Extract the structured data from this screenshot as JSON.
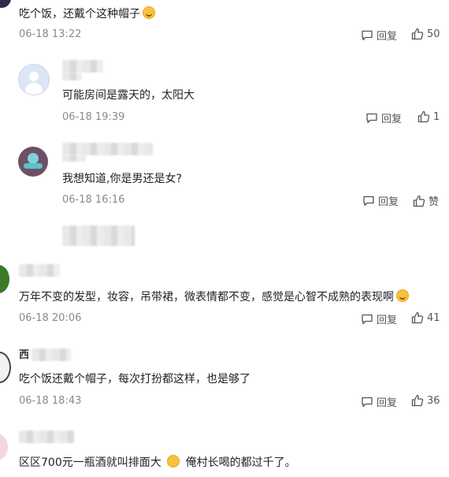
{
  "comments": [
    {
      "text": "吃个饭，还戴个这种帽子",
      "time": "06-18 13:22",
      "reply": "回复",
      "likes": "50"
    },
    {
      "text": "可能房间是露天的，太阳大",
      "time": "06-18 19:39",
      "reply": "回复",
      "likes": "1"
    },
    {
      "text": "我想知道,你是男还是女?",
      "time": "06-18 16:16",
      "reply": "回复",
      "likes": "赞"
    },
    {
      "text": "万年不变的发型，妆容，吊带裙，微表情都不变，感觉是心智不成熟的表现啊",
      "time": "06-18 20:06",
      "reply": "回复",
      "likes": "41"
    },
    {
      "name_prefix": "西",
      "text": "吃个饭还戴个帽子，每次打扮都这样，也是够了",
      "time": "06-18 18:43",
      "reply": "回复",
      "likes": "36"
    },
    {
      "text_a": "区区700元一瓶酒就叫排面大",
      "text_b": "俺村长喝的都过千了。"
    }
  ],
  "colors": {
    "text": "#222222",
    "time": "#8a8a8a",
    "action": "#555555"
  },
  "icons": {
    "reply": "comment-bubble-icon",
    "like": "thumbs-up-icon",
    "emoji": "laughing-face-emoji"
  }
}
